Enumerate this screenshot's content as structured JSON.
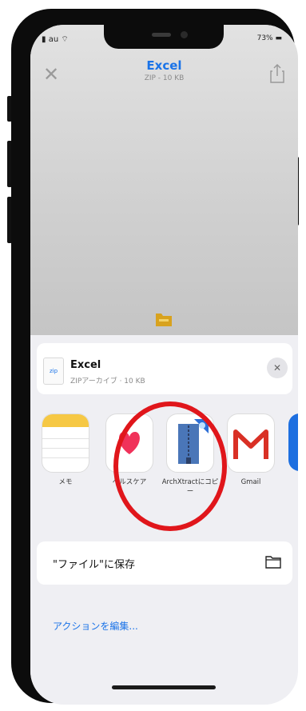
{
  "status_bar": {
    "carrier": "au",
    "battery": "73%"
  },
  "nav": {
    "title": "Excel",
    "subtitle": "ZIP - 10 KB"
  },
  "file_card": {
    "name": "Excel",
    "meta": "ZIPアーカイブ · 10 KB",
    "thumb_label": "zip"
  },
  "apps": [
    {
      "label": "メモ",
      "icon": "notes-icon"
    },
    {
      "label": "ヘルスケア",
      "icon": "health-heart-icon"
    },
    {
      "label": "ArchXtractにコピー",
      "icon": "archxtract-zipper-icon"
    },
    {
      "label": "Gmail",
      "icon": "gmail-icon"
    },
    {
      "label": "",
      "icon": "partial-app-icon"
    }
  ],
  "save_row": {
    "label": "\"ファイル\"に保存",
    "icon": "folder-icon"
  },
  "edit_actions": "アクションを編集...",
  "colors": {
    "accent": "#1a73e8",
    "highlight": "#e0161b",
    "sheet_bg": "#efeff3"
  }
}
